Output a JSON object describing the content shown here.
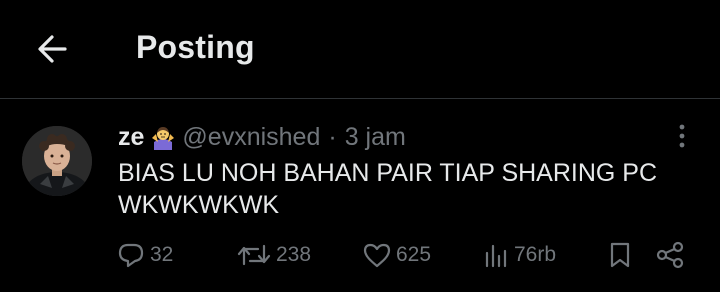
{
  "header": {
    "title": "Posting"
  },
  "post": {
    "display_name": "ze",
    "handle": "@evxnished",
    "separator": "·",
    "time": "3 jam",
    "text_line1": "BIAS LU NOH BAHAN PAIR TIAP SHARING PC",
    "text_line2": "WKWKWKWK",
    "stats": {
      "replies": "32",
      "reposts": "238",
      "likes": "625",
      "views": "76rb"
    }
  },
  "icons": {
    "back": "arrow-left-icon",
    "more": "more-vertical-icon",
    "reply": "reply-icon",
    "repost": "repost-icon",
    "like": "heart-icon",
    "views": "views-icon",
    "bookmark": "bookmark-icon",
    "share": "share-icon"
  },
  "colors": {
    "background": "#000000",
    "text_primary": "#e7e9ea",
    "text_secondary": "#71767b",
    "divider": "#2f3336"
  }
}
